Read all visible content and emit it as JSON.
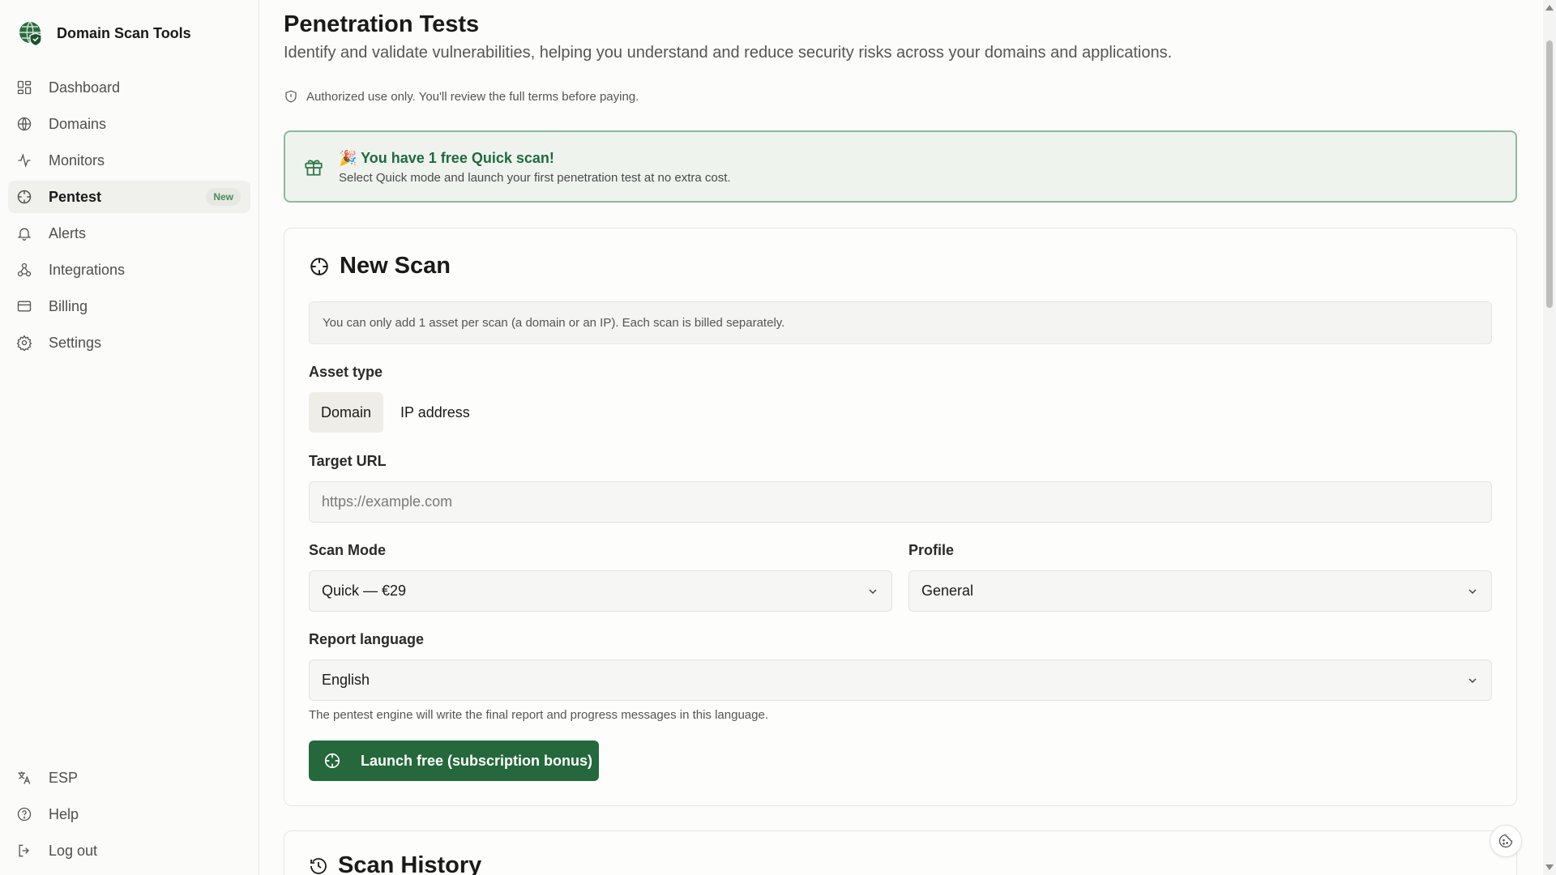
{
  "brand": {
    "name": "Domain Scan Tools"
  },
  "sidebar": {
    "items": [
      {
        "label": "Dashboard",
        "icon": "grid-icon"
      },
      {
        "label": "Domains",
        "icon": "globe-icon"
      },
      {
        "label": "Monitors",
        "icon": "activity-icon"
      },
      {
        "label": "Pentest",
        "icon": "crosshair-icon",
        "badge": "New",
        "active": true
      },
      {
        "label": "Alerts",
        "icon": "bell-icon"
      },
      {
        "label": "Integrations",
        "icon": "webhook-icon"
      },
      {
        "label": "Billing",
        "icon": "credit-card-icon"
      },
      {
        "label": "Settings",
        "icon": "gear-icon"
      }
    ],
    "bottom": [
      {
        "label": "ESP",
        "icon": "language-icon"
      },
      {
        "label": "Help",
        "icon": "help-circle-icon"
      },
      {
        "label": "Log out",
        "icon": "logout-icon"
      }
    ]
  },
  "page": {
    "title": "Penetration Tests",
    "subtitle": "Identify and validate vulnerabilities, helping you understand and reduce security risks across your domains and applications.",
    "auth_note": "Authorized use only. You'll review the full terms before paying."
  },
  "promo": {
    "emoji": "🎉",
    "title": "You have 1 free Quick scan!",
    "text": "Select Quick mode and launch your first penetration test at no extra cost."
  },
  "new_scan": {
    "title": "New Scan",
    "info": "You can only add 1 asset per scan (a domain or an IP). Each scan is billed separately.",
    "asset_type_label": "Asset type",
    "asset_types": [
      "Domain",
      "IP address"
    ],
    "asset_type_selected": "Domain",
    "target_url_label": "Target URL",
    "target_url_placeholder": "https://example.com",
    "scan_mode_label": "Scan Mode",
    "scan_mode_value": "Quick — €29",
    "profile_label": "Profile",
    "profile_value": "General",
    "report_language_label": "Report language",
    "report_language_value": "English",
    "report_language_help": "The pentest engine will write the final report and progress messages in this language.",
    "launch_label": "Launch free (subscription bonus)"
  },
  "history": {
    "title": "Scan History"
  },
  "colors": {
    "accent": "#24683b",
    "promo_border": "#8fb99a",
    "promo_bg": "#eef3ee"
  }
}
